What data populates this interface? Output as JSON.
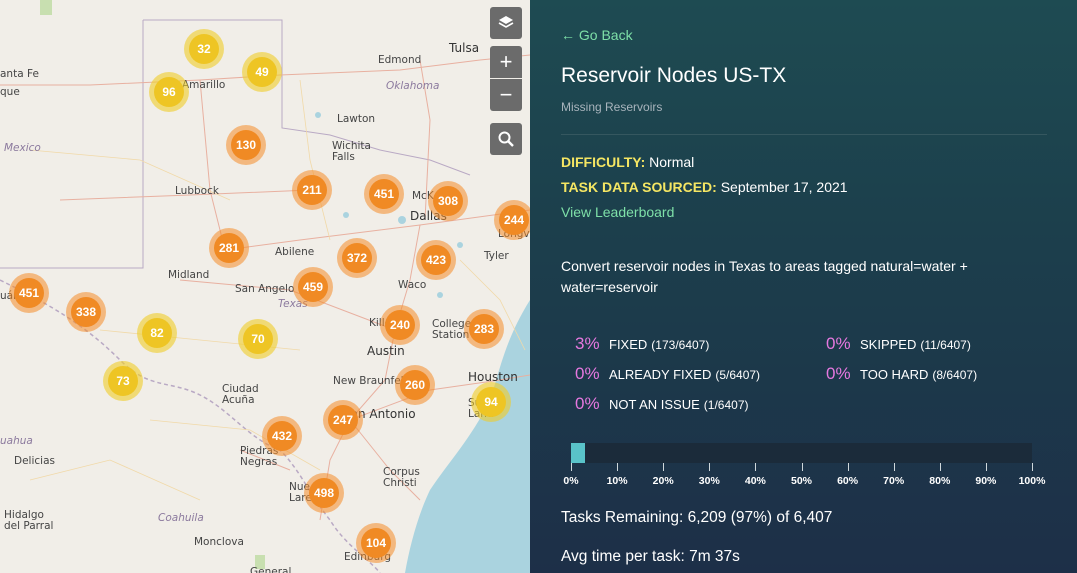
{
  "map": {
    "places": [
      {
        "name": "Tulsa"
      },
      {
        "name": "Edmond"
      },
      {
        "name": "Oklahoma"
      },
      {
        "name": "Amarillo"
      },
      {
        "name": "Lawton"
      },
      {
        "name": "Wichita\nFalls"
      },
      {
        "name": "Lubbock"
      },
      {
        "name": "McK"
      },
      {
        "name": "Dallas"
      },
      {
        "name": "Longvi"
      },
      {
        "name": "Abilene"
      },
      {
        "name": "Tyler"
      },
      {
        "name": "Midland"
      },
      {
        "name": "San Angelo"
      },
      {
        "name": "Texas"
      },
      {
        "name": "Waco"
      },
      {
        "name": "Kille"
      },
      {
        "name": "College\nStation"
      },
      {
        "name": "Austin"
      },
      {
        "name": "New Braunfels"
      },
      {
        "name": "Houston"
      },
      {
        "name": "Ciudad\nAcuña"
      },
      {
        "name": "San Antonio"
      },
      {
        "name": "Sug\nLand"
      },
      {
        "name": "Piedras\nNegras"
      },
      {
        "name": "Corpus\nChristi"
      },
      {
        "name": "Nue\nLare"
      },
      {
        "name": "Delicias"
      },
      {
        "name": "Coahuila"
      },
      {
        "name": "Hidalgo\ndel Parral"
      },
      {
        "name": "Monclova"
      },
      {
        "name": "Edinburg"
      },
      {
        "name": "Mexico"
      },
      {
        "name": "anta Fe"
      },
      {
        "name": "que"
      },
      {
        "name": "uahua"
      },
      {
        "name": "uár"
      },
      {
        "name": "General"
      }
    ],
    "clusters": [
      {
        "count": "32",
        "color": "yellow"
      },
      {
        "count": "49",
        "color": "yellow"
      },
      {
        "count": "96",
        "color": "yellow"
      },
      {
        "count": "130",
        "color": "orange"
      },
      {
        "count": "211",
        "color": "orange"
      },
      {
        "count": "451",
        "color": "orange"
      },
      {
        "count": "308",
        "color": "orange"
      },
      {
        "count": "244",
        "color": "orange"
      },
      {
        "count": "281",
        "color": "orange"
      },
      {
        "count": "372",
        "color": "orange"
      },
      {
        "count": "423",
        "color": "orange"
      },
      {
        "count": "459",
        "color": "orange"
      },
      {
        "count": "451",
        "color": "orange"
      },
      {
        "count": "338",
        "color": "orange"
      },
      {
        "count": "82",
        "color": "yellow"
      },
      {
        "count": "70",
        "color": "yellow"
      },
      {
        "count": "240",
        "color": "orange"
      },
      {
        "count": "283",
        "color": "orange"
      },
      {
        "count": "73",
        "color": "yellow"
      },
      {
        "count": "260",
        "color": "orange"
      },
      {
        "count": "94",
        "color": "yellow"
      },
      {
        "count": "247",
        "color": "orange"
      },
      {
        "count": "432",
        "color": "orange"
      },
      {
        "count": "498",
        "color": "orange"
      },
      {
        "count": "104",
        "color": "orange"
      }
    ],
    "controls": {
      "layers_icon": "layers-icon",
      "zoom_in": "+",
      "zoom_out": "−",
      "search_icon": "search-icon"
    }
  },
  "panel": {
    "go_back": "← Go Back",
    "title": "Reservoir Nodes US-TX",
    "subtitle": "Missing Reservoirs",
    "difficulty_key": "DIFFICULTY:",
    "difficulty_val": "Normal",
    "sourced_key": "TASK DATA SOURCED:",
    "sourced_val": "September 17, 2021",
    "leaderboard": "View Leaderboard",
    "description": "Convert reservoir nodes in Texas to areas tagged natural=water + water=reservoir",
    "stats": [
      {
        "pct": "3%",
        "label": "FIXED",
        "count": "(173/6407)"
      },
      {
        "pct": "0%",
        "label": "SKIPPED",
        "count": "(11/6407)"
      },
      {
        "pct": "0%",
        "label": "ALREADY FIXED",
        "count": "(5/6407)"
      },
      {
        "pct": "0%",
        "label": "TOO HARD",
        "count": "(8/6407)"
      },
      {
        "pct": "0%",
        "label": "NOT AN ISSUE",
        "count": "(1/6407)"
      }
    ],
    "progress_fraction": 0.03,
    "progress_ticks": [
      "0%",
      "10%",
      "20%",
      "30%",
      "40%",
      "50%",
      "60%",
      "70%",
      "80%",
      "90%",
      "100%"
    ],
    "tasks_remaining": "Tasks Remaining: 6,209 (97%) of 6,407",
    "avg_time": "Avg time per task:  7m 37s",
    "colors": {
      "accent_green": "#7ee0a8",
      "key_yellow": "#f5e663",
      "pct_pink": "#e678e0",
      "progress_fill": "#59c3c9"
    }
  }
}
